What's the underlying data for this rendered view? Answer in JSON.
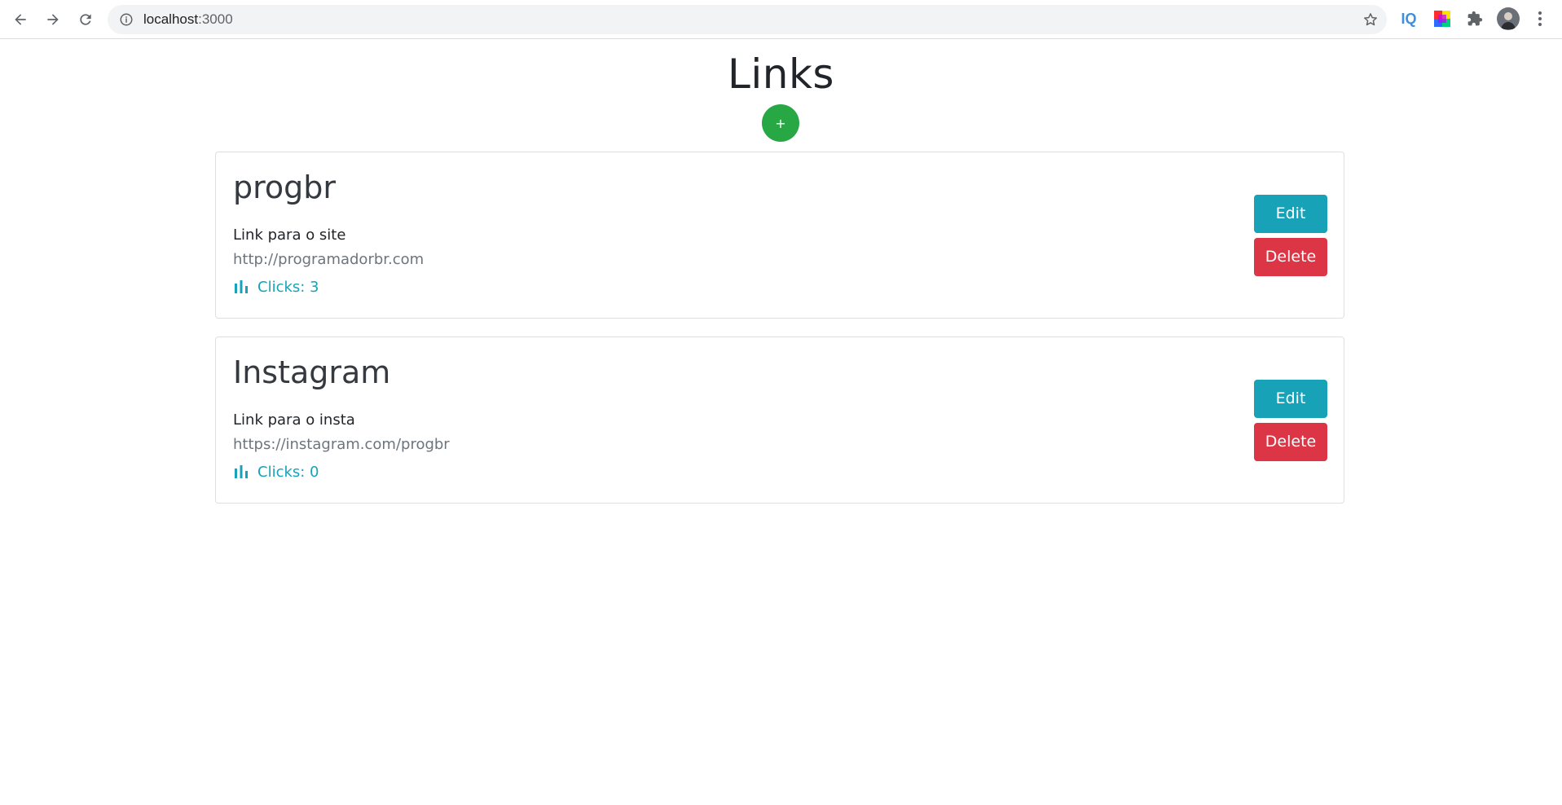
{
  "browser": {
    "url_host": "localhost",
    "url_port": ":3000",
    "extensions": [
      {
        "name": "IQ",
        "label": "IQ"
      },
      {
        "name": "color-picker",
        "label": ""
      },
      {
        "name": "extensions",
        "label": ""
      }
    ]
  },
  "page": {
    "title": "Links",
    "add_label": "+"
  },
  "links": [
    {
      "title": "progbr",
      "description": "Link para o site",
      "url": "http://programadorbr.com",
      "clicks_label": "Clicks: 3",
      "edit_label": "Edit",
      "delete_label": "Delete"
    },
    {
      "title": "Instagram",
      "description": "Link para o insta",
      "url": "https://instagram.com/progbr",
      "clicks_label": "Clicks: 0",
      "edit_label": "Edit",
      "delete_label": "Delete"
    }
  ],
  "colors": {
    "add": "#28a745",
    "edit": "#17a2b8",
    "delete": "#dc3545",
    "clicks": "#17a2b8",
    "url": "#6c757d"
  }
}
